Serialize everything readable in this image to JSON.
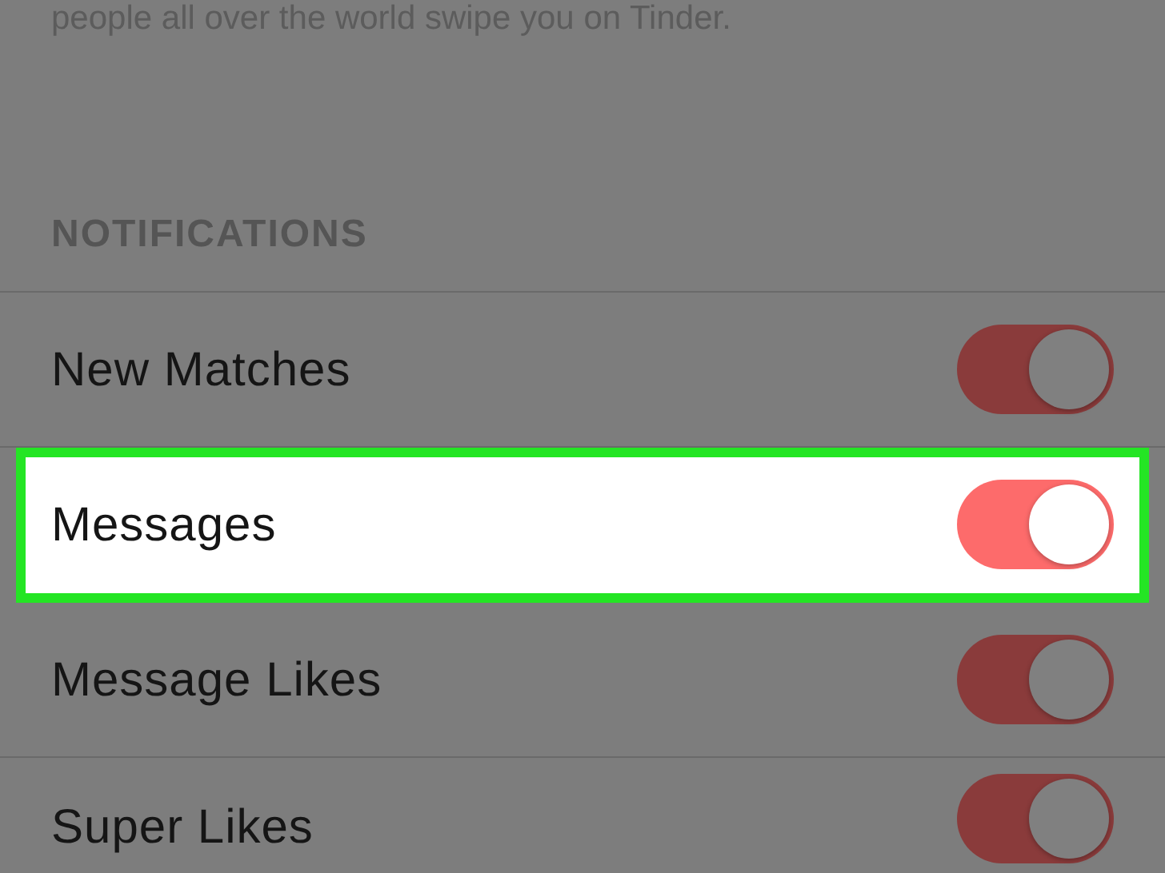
{
  "description": "people all over the world swipe you on Tinder.",
  "section_header": "NOTIFICATIONS",
  "settings": [
    {
      "label": "New Matches",
      "on": true,
      "selected": false
    },
    {
      "label": "Messages",
      "on": true,
      "selected": true
    },
    {
      "label": "Message Likes",
      "on": true,
      "selected": false
    },
    {
      "label": "Super Likes",
      "on": true,
      "selected": false
    }
  ]
}
